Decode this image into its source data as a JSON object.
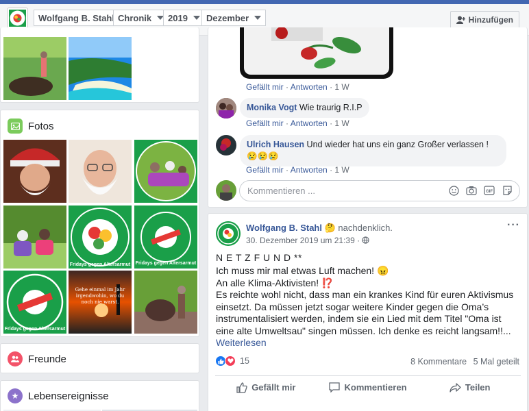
{
  "header": {
    "profile_name": "Wolfgang B. Stahl",
    "section": "Chronik",
    "year": "2019",
    "month": "Dezember",
    "add_button": "Hinzufügen"
  },
  "left": {
    "photos_title": "Fotos",
    "friends_title": "Freunde",
    "life_events_title": "Lebensereignisse",
    "photo_captions": [
      "Fridays gegen Altersarmut",
      "Fridays gegen Altersarmut",
      "Fridays gegen Altersarmut",
      "Gehe einmal im Jahr irgendwohin, wo du noch nie warst."
    ]
  },
  "comments": [
    {
      "author": "",
      "text": "",
      "like": "Gefällt mir",
      "reply": "Antworten",
      "age": "1 W"
    },
    {
      "author": "Monika Vogt",
      "text": "Wie traurig R.I.P",
      "like": "Gefällt mir",
      "reply": "Antworten",
      "age": "1 W"
    },
    {
      "author": "Ulrich Hausen",
      "text": "Und wieder hat uns ein ganz Großer verlassen ! 😢😢😢",
      "like": "Gefällt mir",
      "reply": "Antworten",
      "age": "1 W"
    }
  ],
  "comment_box": {
    "placeholder": "Kommentieren ..."
  },
  "post": {
    "author": "Wolfgang B. Stahl",
    "feeling": "nachdenklich.",
    "date": "30. Dezember 2019 um 21:39 ·",
    "title": "N E T Z F U N D **",
    "lines": [
      "Ich muss mir mal etwas Luft machen! 😠",
      "An alle Klima-Aktivisten! ⁉️",
      "Es reichte wohl nicht, dass man ein krankes Kind für euren Aktivismus einsetzt. Da müssen jetzt sogar weitere Kinder gegen die Oma’s instrumentalisiert werden, indem sie ein Lied mit dem Titel \"Oma ist eine alte Umweltsau\" singen müssen. Ich denke es reicht langsam!!..."
    ],
    "read_more": "Weiterlesen",
    "reactions_count": "15",
    "comments_count": "8 Kommentare",
    "shares_count": "5 Mal geteilt",
    "like_label": "Gefällt mir",
    "comment_label": "Kommentieren",
    "share_label": "Teilen"
  },
  "colors": {
    "accent": "#4267b2",
    "link": "#385898",
    "green": "#1a9f49"
  }
}
